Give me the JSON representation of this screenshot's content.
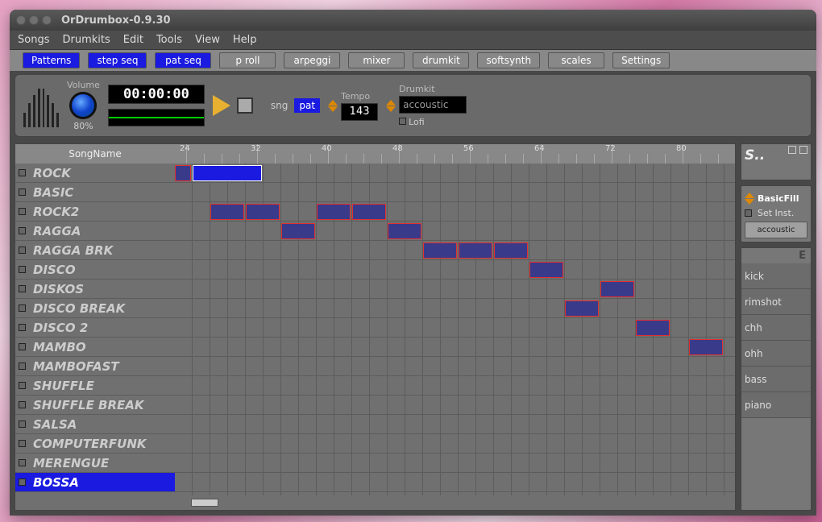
{
  "window": {
    "title": "OrDrumbox-0.9.30"
  },
  "menu": {
    "items": [
      "Songs",
      "Drumkits",
      "Edit",
      "Tools",
      "View",
      "Help"
    ]
  },
  "tabs": {
    "items": [
      {
        "label": "Patterns",
        "active": true
      },
      {
        "label": "step seq",
        "active": true
      },
      {
        "label": "pat seq",
        "active": true
      },
      {
        "label": "p roll",
        "active": false
      },
      {
        "label": "arpeggi",
        "active": false
      },
      {
        "label": "mixer",
        "active": false
      },
      {
        "label": "drumkit",
        "active": false
      },
      {
        "label": "softsynth",
        "active": false
      },
      {
        "label": "scales",
        "active": false
      },
      {
        "label": "Settings",
        "active": false
      }
    ]
  },
  "transport": {
    "volume_label": "Volume",
    "volume_value": "80%",
    "timecode": "00:00:00",
    "sng_label": "sng",
    "pat_label": "pat",
    "pat_active": true,
    "tempo_label": "Tempo",
    "tempo_value": "143",
    "drumkit_label": "Drumkit",
    "drumkit_value": "accoustic",
    "lofi_label": "Lofi",
    "lofi_checked": false
  },
  "sequencer": {
    "header_label": "SongName",
    "ruler_majors": [
      24,
      32,
      40,
      48,
      56,
      64,
      72,
      80
    ],
    "tracks": [
      {
        "name": "ROCK"
      },
      {
        "name": "BASIC"
      },
      {
        "name": "ROCK2"
      },
      {
        "name": "RAGGA"
      },
      {
        "name": "RAGGA BRK"
      },
      {
        "name": "DISCO"
      },
      {
        "name": "DISKOS"
      },
      {
        "name": "DISCO BREAK"
      },
      {
        "name": "DISCO 2"
      },
      {
        "name": "MAMBO"
      },
      {
        "name": "MAMBOFAST"
      },
      {
        "name": "SHUFFLE"
      },
      {
        "name": "SHUFFLE BREAK"
      },
      {
        "name": "SALSA"
      },
      {
        "name": "COMPUTERFUNK"
      },
      {
        "name": "MERENGUE"
      },
      {
        "name": "BOSSA",
        "selected": true
      }
    ],
    "clips": [
      {
        "track": 0,
        "start": 0,
        "len": 1
      },
      {
        "track": 0,
        "start": 1,
        "len": 4,
        "selected": true
      },
      {
        "track": 2,
        "start": 2,
        "len": 2
      },
      {
        "track": 2,
        "start": 4,
        "len": 2
      },
      {
        "track": 2,
        "start": 8,
        "len": 2
      },
      {
        "track": 2,
        "start": 10,
        "len": 2
      },
      {
        "track": 3,
        "start": 6,
        "len": 2
      },
      {
        "track": 3,
        "start": 12,
        "len": 2
      },
      {
        "track": 4,
        "start": 14,
        "len": 2
      },
      {
        "track": 4,
        "start": 16,
        "len": 2
      },
      {
        "track": 4,
        "start": 18,
        "len": 2
      },
      {
        "track": 5,
        "start": 20,
        "len": 2
      },
      {
        "track": 6,
        "start": 24,
        "len": 2
      },
      {
        "track": 7,
        "start": 22,
        "len": 2
      },
      {
        "track": 8,
        "start": 26,
        "len": 2
      },
      {
        "track": 9,
        "start": 29,
        "len": 2
      }
    ]
  },
  "sidebar": {
    "top_label": "S..",
    "pattern_name": "BasicFill",
    "set_inst_label": "Set Inst.",
    "drumkit_btn": "accoustic",
    "e_label": "E",
    "instruments": [
      "kick",
      "rimshot",
      "chh",
      "ohh",
      "bass",
      "piano"
    ]
  }
}
